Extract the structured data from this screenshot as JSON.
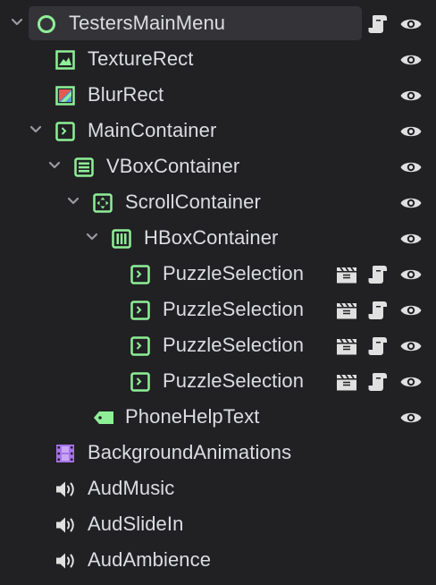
{
  "colors": {
    "background": "#212124",
    "selected_row": "#343438",
    "text": "#dcdde1",
    "control_node_green": "#8eef97",
    "node2d_purple": "#a472e8",
    "audio_icon": "#e0e0e0",
    "arrow": "#9a9ba0",
    "eye_icon": "#e0e0e0"
  },
  "scene_tree": {
    "nodes": [
      {
        "label": "TestersMainMenu",
        "icon": "control-circle-icon",
        "expanded": true,
        "selected": true,
        "indicators": [
          "script-icon",
          "visibility-eye-icon"
        ]
      },
      {
        "label": "TextureRect",
        "icon": "texture-rect-icon",
        "indicators": [
          "visibility-eye-icon"
        ]
      },
      {
        "label": "BlurRect",
        "icon": "color-rect-icon",
        "indicators": [
          "visibility-eye-icon"
        ]
      },
      {
        "label": "MainContainer",
        "icon": "container-icon",
        "expanded": true,
        "indicators": [
          "visibility-eye-icon"
        ]
      },
      {
        "label": "VBoxContainer",
        "icon": "vbox-container-icon",
        "expanded": true,
        "indicators": [
          "visibility-eye-icon"
        ]
      },
      {
        "label": "ScrollContainer",
        "icon": "scroll-container-icon",
        "expanded": true,
        "indicators": [
          "visibility-eye-icon"
        ]
      },
      {
        "label": "HBoxContainer",
        "icon": "hbox-container-icon",
        "expanded": true,
        "indicators": [
          "visibility-eye-icon"
        ]
      },
      {
        "label": "PuzzleSelection",
        "icon": "container-icon",
        "indicators": [
          "instance-clapper-icon",
          "script-icon",
          "visibility-eye-icon"
        ]
      },
      {
        "label": "PuzzleSelection",
        "icon": "container-icon",
        "indicators": [
          "instance-clapper-icon",
          "script-icon",
          "visibility-eye-icon"
        ]
      },
      {
        "label": "PuzzleSelection",
        "icon": "container-icon",
        "indicators": [
          "instance-clapper-icon",
          "script-icon",
          "visibility-eye-icon"
        ]
      },
      {
        "label": "PuzzleSelection",
        "icon": "container-icon",
        "indicators": [
          "instance-clapper-icon",
          "script-icon",
          "visibility-eye-icon"
        ]
      },
      {
        "label": "PhoneHelpText",
        "icon": "label-tag-icon",
        "indicators": [
          "visibility-eye-icon"
        ]
      },
      {
        "label": "BackgroundAnimations",
        "icon": "animated-sprite-icon",
        "indicators": []
      },
      {
        "label": "AudMusic",
        "icon": "audio-speaker-icon",
        "indicators": []
      },
      {
        "label": "AudSlideIn",
        "icon": "audio-speaker-icon",
        "indicators": []
      },
      {
        "label": "AudAmbience",
        "icon": "audio-speaker-icon",
        "indicators": []
      }
    ]
  }
}
